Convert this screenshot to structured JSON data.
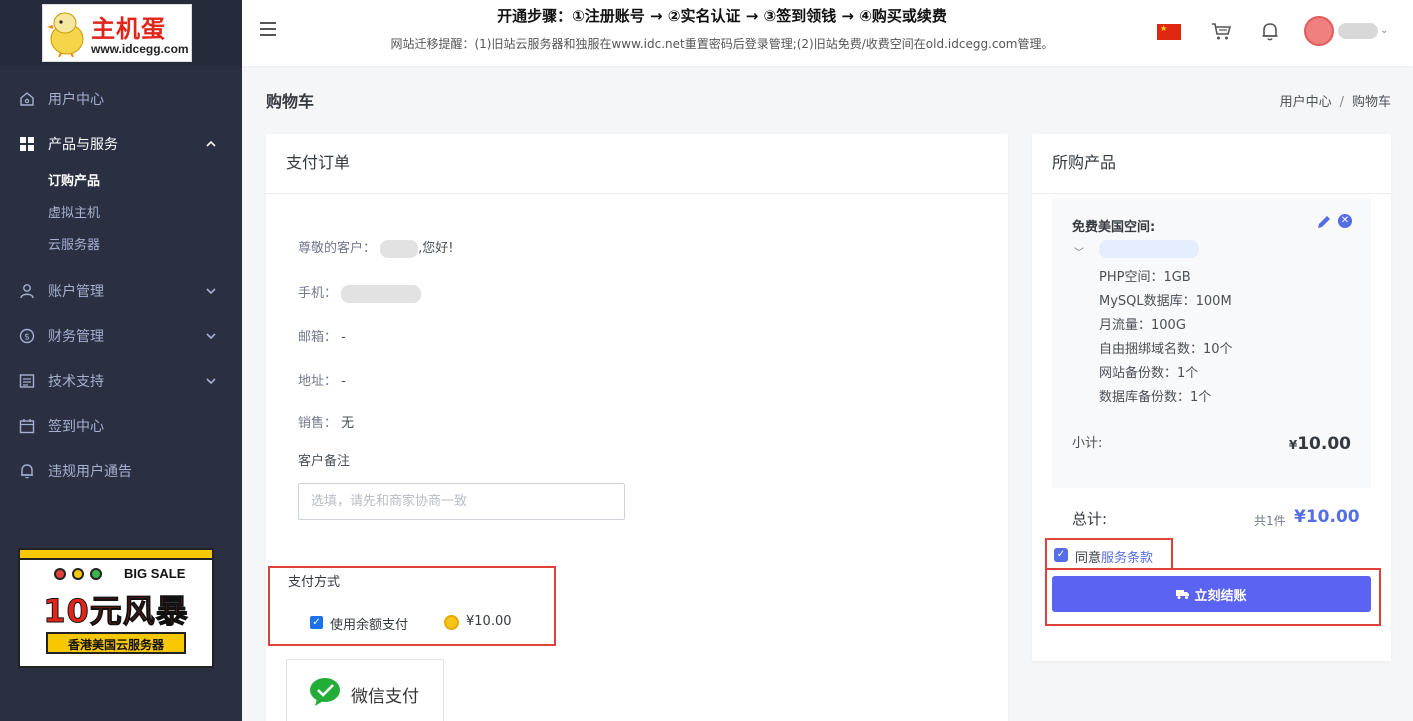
{
  "logo": {
    "brand": "主机蛋",
    "url": "www.idcegg.com"
  },
  "header": {
    "notice_title": "开通步骤：①注册账号 → ②实名认证 → ③签到领钱 → ④购买或续费",
    "notice_text": "网站迁移提醒：(1)旧站云服务器和独服在www.idc.net重置密码后登录管理;(2)旧站免费/收费空间在old.idcegg.com管理。",
    "language_flag": "china-flag-icon"
  },
  "sidebar": {
    "items": [
      {
        "label": "用户中心",
        "icon": "home-icon"
      },
      {
        "label": "产品与服务",
        "icon": "grid-icon",
        "expanded": true,
        "children": [
          "订购产品",
          "虚拟主机",
          "云服务器"
        ],
        "active_child": "订购产品"
      },
      {
        "label": "账户管理",
        "icon": "user-icon"
      },
      {
        "label": "财务管理",
        "icon": "dollar-icon"
      },
      {
        "label": "技术支持",
        "icon": "ticket-icon"
      },
      {
        "label": "签到中心",
        "icon": "calendar-icon"
      },
      {
        "label": "违规用户通告",
        "icon": "bell-icon"
      }
    ]
  },
  "promo": {
    "tag": "BIG SALE",
    "headline": "10元风暴",
    "sub": "香港美国云服务器"
  },
  "page": {
    "title": "购物车",
    "breadcrumb": [
      "用户中心",
      "购物车"
    ]
  },
  "order": {
    "title": "支付订单",
    "greeting_prefix": "尊敬的客户：",
    "greeting_suffix": ",您好!",
    "phone_label": "手机：",
    "email_label": "邮箱：",
    "email_value": "-",
    "address_label": "地址：",
    "address_value": "-",
    "sales_label": "销售：",
    "sales_value": "无",
    "remark_label": "客户备注",
    "remark_placeholder": "选填，请先和商家协商一致",
    "payment_title": "支付方式",
    "balance_label": "使用余额支付",
    "balance_amount": "¥10.00",
    "wechat_label": "微信支付"
  },
  "cart": {
    "title": "所购产品",
    "product_name": "免费美国空间:",
    "specs": [
      "PHP空间：1GB",
      "MySQL数据库：100M",
      "月流量：100G",
      "自由捆绑域名数：10个",
      "网站备份数：1个",
      "数据库备份数：1个"
    ],
    "subtotal_label": "小计:",
    "subtotal_currency": "¥",
    "subtotal_value": "10.00",
    "total_label": "总计:",
    "total_count": "共1件",
    "total_value": "¥10.00",
    "agree_prefix": "同意",
    "agree_link": "服务条款",
    "checkout_label": "立刻结账"
  },
  "colors": {
    "sidebar_bg": "#2a3042",
    "accent": "#556ee6",
    "checkout_button": "#5b63f2",
    "highlight_frame": "#e0413b"
  }
}
